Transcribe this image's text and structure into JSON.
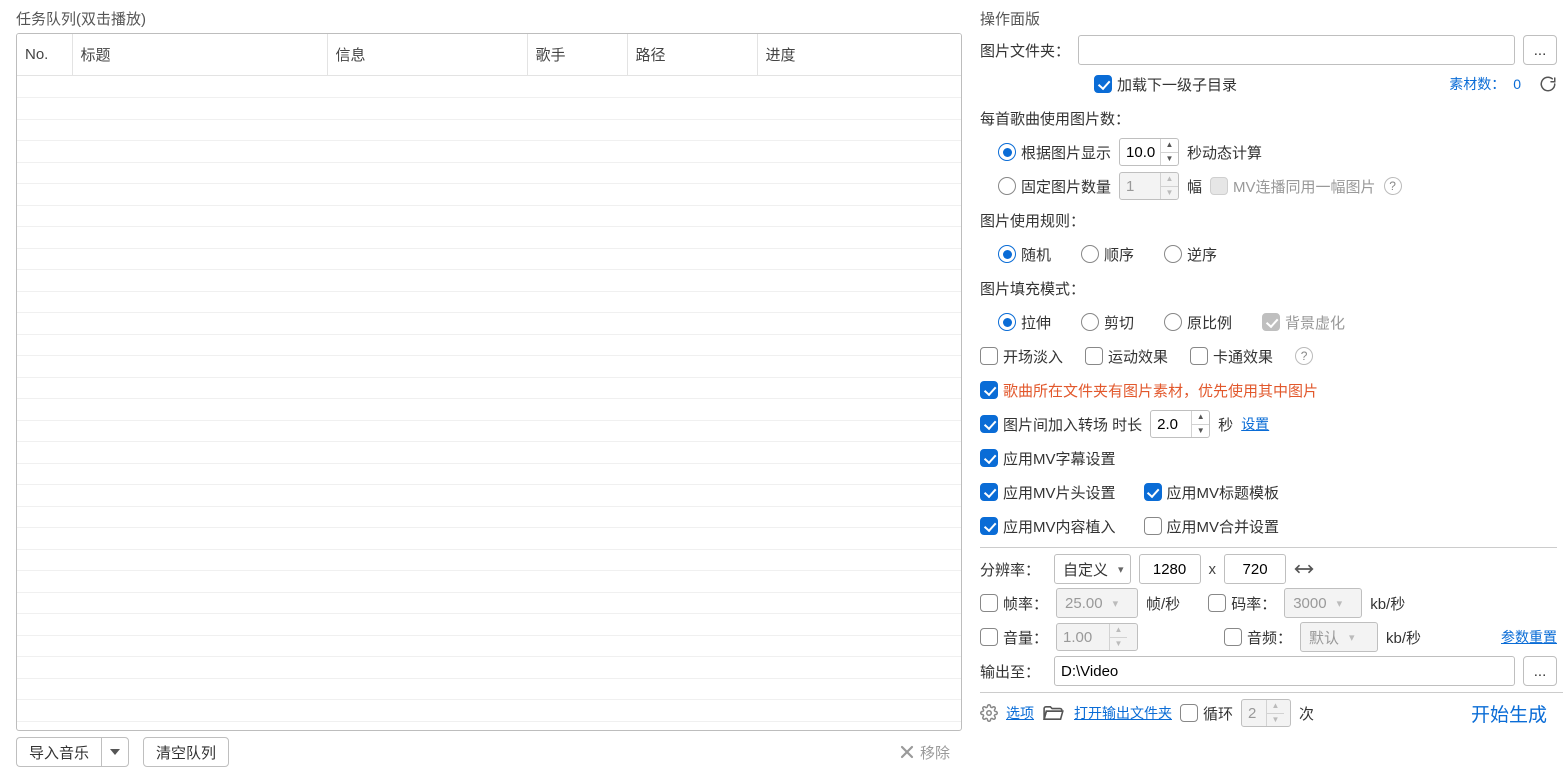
{
  "left": {
    "group_title": "任务队列(双击播放)",
    "columns": {
      "no": "No.",
      "title": "标题",
      "info": "信息",
      "artist": "歌手",
      "path": "路径",
      "progress": "进度"
    },
    "footer": {
      "import": "导入音乐",
      "clear": "清空队列",
      "remove": "移除"
    }
  },
  "right": {
    "group_title": "操作面版",
    "image_folder_label": "图片文件夹：",
    "image_folder_value": "",
    "browse_btn": "...",
    "load_sub_dir": "加载下一级子目录",
    "material_count_label": "素材数：",
    "material_count": "0",
    "per_song_image_label": "每首歌曲使用图片数：",
    "by_display": {
      "label": "根据图片显示",
      "value": "10.0",
      "suffix": "秒动态计算"
    },
    "fixed_count": {
      "label": "固定图片数量",
      "value": "1",
      "suffix": "幅",
      "share_one": "MV连播同用一幅图片"
    },
    "image_rule_label": "图片使用规则：",
    "rules": {
      "random": "随机",
      "sequential": "顺序",
      "reverse": "逆序"
    },
    "fill_mode_label": "图片填充模式：",
    "fill": {
      "stretch": "拉伸",
      "crop": "剪切",
      "ratio": "原比例",
      "blur_bg": "背景虚化"
    },
    "fx": {
      "fade_in": "开场淡入",
      "motion": "运动效果",
      "cartoon": "卡通效果"
    },
    "song_folder_images": "歌曲所在文件夹有图片素材，优先使用其中图片",
    "transition": {
      "label_a": "图片间加入转场  时长",
      "value": "2.0",
      "label_b": "秒",
      "settings": "设置"
    },
    "mv": {
      "subtitle": "应用MV字幕设置",
      "intro": "应用MV片头设置",
      "title_tpl": "应用MV标题模板",
      "content": "应用MV内容植入",
      "merge": "应用MV合并设置"
    },
    "resolution": {
      "label": "分辨率：",
      "preset": "自定义",
      "width": "1280",
      "x": "x",
      "height": "720"
    },
    "fps": {
      "label": "帧率：",
      "value": "25.00",
      "unit": "帧/秒"
    },
    "bitrate": {
      "label": "码率：",
      "value": "3000",
      "unit": "kb/秒"
    },
    "volume": {
      "label": "音量：",
      "value": "1.00"
    },
    "audio": {
      "label": "音频：",
      "value": "默认",
      "unit": "kb/秒"
    },
    "reset_link": "参数重置",
    "output": {
      "label": "输出至：",
      "path": "D:\\Video",
      "browse": "..."
    },
    "bottom": {
      "options": "选项",
      "open_folder": "打开输出文件夹",
      "loop_label": "循环",
      "loop_value": "2",
      "loop_unit": "次",
      "start": "开始生成"
    }
  }
}
